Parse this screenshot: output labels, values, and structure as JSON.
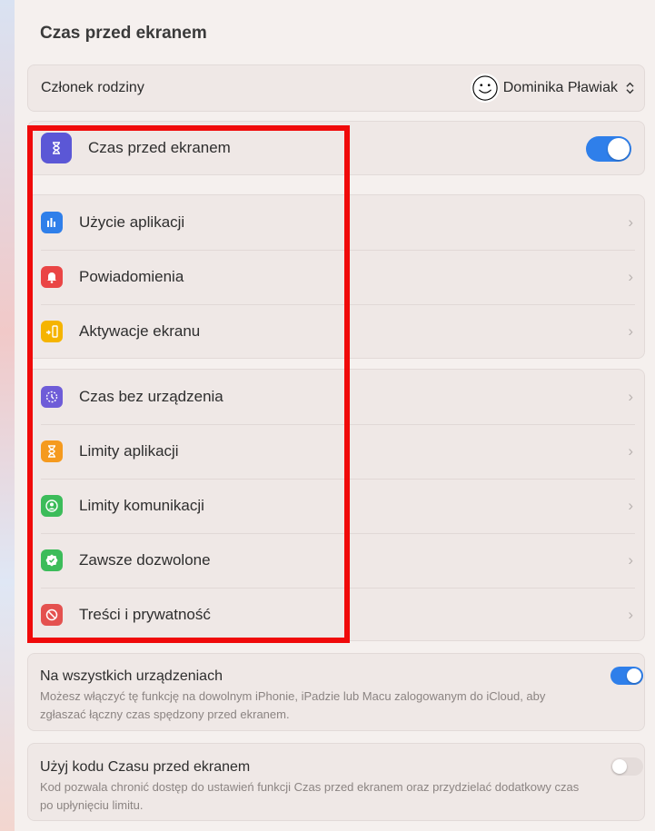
{
  "header": {
    "title": "Czas przed ekranem"
  },
  "family": {
    "label": "Członek rodziny",
    "selected_member": "Dominika Pławiak",
    "avatar_icon": "smiley-avatar-icon",
    "chevron_icon": "updown-chevron-icon"
  },
  "screen_time": {
    "label": "Czas przed ekranem",
    "enabled": true,
    "icon": "hourglass-icon"
  },
  "group1": [
    {
      "label": "Użycie aplikacji",
      "icon": "bar-chart-icon",
      "color": "#2f7fea"
    },
    {
      "label": "Powiadomienia",
      "icon": "bell-icon",
      "color": "#ea4545"
    },
    {
      "label": "Aktywacje ekranu",
      "icon": "pickup-icon",
      "color": "#f5b400"
    }
  ],
  "group2": [
    {
      "label": "Czas bez urządzenia",
      "icon": "downtime-icon",
      "color": "#6e5cd8"
    },
    {
      "label": "Limity aplikacji",
      "icon": "hourglass-icon",
      "color": "#f59a1e"
    },
    {
      "label": "Limity komunikacji",
      "icon": "contact-icon",
      "color": "#3cbc5a"
    },
    {
      "label": "Zawsze dozwolone",
      "icon": "checkmark-seal-icon",
      "color": "#3cbc5a"
    },
    {
      "label": "Treści i prywatność",
      "icon": "no-entry-icon",
      "color": "#e4514f"
    }
  ],
  "all_devices": {
    "title": "Na wszystkich urządzeniach",
    "description": "Możesz włączyć tę funkcję na dowolnym iPhonie, iPadzie lub Macu zalogowanym do iCloud, aby zgłaszać łączny czas spędzony przed ekranem.",
    "enabled": true
  },
  "passcode": {
    "title": "Użyj kodu Czasu przed ekranem",
    "description": "Kod pozwala chronić dostęp do ustawień funkcji Czas przed ekranem oraz przydzielać dodatkowy czas po upłynięciu limitu.",
    "enabled": false
  },
  "colors": {
    "accent": "#2f7fea",
    "highlight": "#f00a0a",
    "screen_time_icon": "#5b57d6"
  }
}
